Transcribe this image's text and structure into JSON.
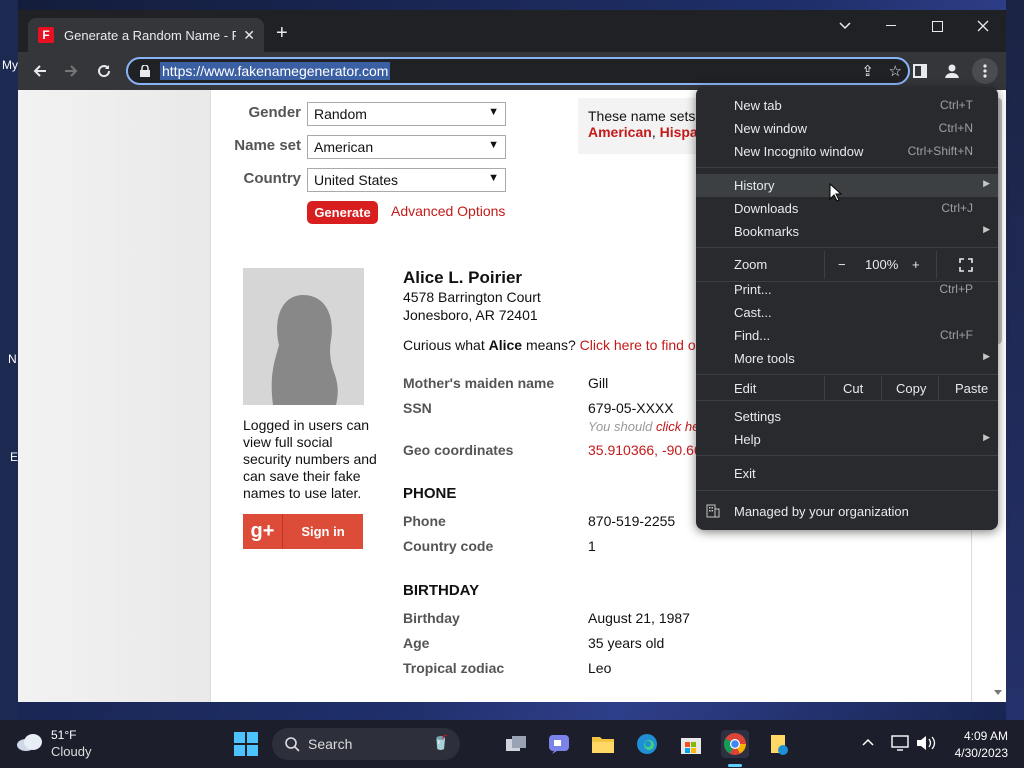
{
  "desktop": {
    "label_my": "My",
    "label_n": "N",
    "label_e": "E"
  },
  "browser": {
    "tab_title": "Generate a Random Name - Fake Name Generator",
    "tab_close": "✕",
    "new_tab_icon": "+",
    "url": "https://www.fakenamegenerator.com"
  },
  "form": {
    "gender_label": "Gender",
    "gender_value": "Random",
    "nameset_label": "Name set",
    "nameset_value": "American",
    "country_label": "Country",
    "country_value": "United States",
    "generate_label": "Generate",
    "advanced_label": "Advanced Options",
    "info_text": "These name sets",
    "info_red1": "American",
    "info_sep": ", ",
    "info_red2": "Hispa"
  },
  "login": {
    "text": "Logged in users can view full social security numbers and can save their fake names to use later.",
    "g_label": "g+",
    "sign_in": "Sign in"
  },
  "person": {
    "name": "Alice L. Poirier",
    "address1": "4578 Barrington Court",
    "address2": "Jonesboro, AR 72401",
    "curious_prefix": "Curious what ",
    "first_name": "Alice",
    "curious_suffix": " means? ",
    "curious_link": "Click here to find ou",
    "rows": [
      {
        "label": "Mother's maiden name",
        "value": "Gill"
      },
      {
        "label": "SSN",
        "value": "679-05-XXXX"
      },
      {
        "label": "Geo coordinates",
        "value": "35.910366, -90.66"
      }
    ],
    "ssn_note": "You should ",
    "ssn_note_link": "click he",
    "phone_heading": "PHONE",
    "phone_rows": [
      {
        "label": "Phone",
        "value": "870-519-2255"
      },
      {
        "label": "Country code",
        "value": "1"
      }
    ],
    "birthday_heading": "BIRTHDAY",
    "birthday_rows": [
      {
        "label": "Birthday",
        "value": "August 21, 1987"
      },
      {
        "label": "Age",
        "value": "35 years old"
      },
      {
        "label": "Tropical zodiac",
        "value": "Leo"
      }
    ]
  },
  "menu": {
    "items": [
      {
        "label": "New tab",
        "shortcut": "Ctrl+T"
      },
      {
        "label": "New window",
        "shortcut": "Ctrl+N"
      },
      {
        "label": "New Incognito window",
        "shortcut": "Ctrl+Shift+N"
      },
      {
        "label": "History",
        "shortcut": ""
      },
      {
        "label": "Downloads",
        "shortcut": "Ctrl+J"
      },
      {
        "label": "Bookmarks",
        "shortcut": ""
      },
      {
        "label": "Print...",
        "shortcut": "Ctrl+P"
      },
      {
        "label": "Cast...",
        "shortcut": ""
      },
      {
        "label": "Find...",
        "shortcut": "Ctrl+F"
      },
      {
        "label": "More tools",
        "shortcut": ""
      },
      {
        "label": "Settings",
        "shortcut": ""
      },
      {
        "label": "Help",
        "shortcut": ""
      },
      {
        "label": "Exit",
        "shortcut": ""
      },
      {
        "label": "Managed by your organization",
        "shortcut": ""
      }
    ],
    "zoom_label": "Zoom",
    "zoom_minus": "−",
    "zoom_value": "100%",
    "zoom_plus": "+",
    "edit_label": "Edit",
    "cut_label": "Cut",
    "copy_label": "Copy",
    "paste_label": "Paste"
  },
  "taskbar": {
    "temp": "51°F",
    "weather": "Cloudy",
    "search_label": "Search",
    "time": "4:09 AM",
    "date": "4/30/2023"
  }
}
